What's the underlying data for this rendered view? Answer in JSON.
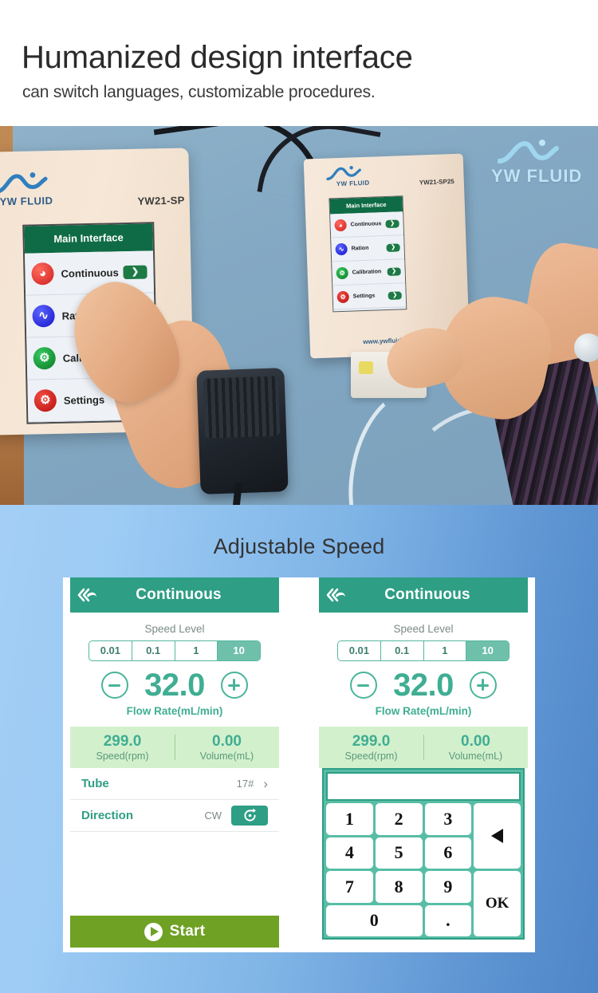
{
  "header": {
    "title": "Humanized design interface",
    "subtitle": "can switch languages, customizable procedures."
  },
  "photo": {
    "watermark_logo": "YW FLUID",
    "left_device": {
      "brand": "YW FLUID",
      "model": "YW21-SP",
      "screen_title": "Main Interface",
      "menu": [
        {
          "label": "Continuous",
          "icon": "drop-icon",
          "glyph": "◕",
          "arrow": "❯",
          "color": "#cf1f1f"
        },
        {
          "label": "Ration",
          "icon": "wave-icon",
          "glyph": "∿",
          "arrow": "❯",
          "color": "#1414c8"
        },
        {
          "label": "Calibration",
          "icon": "gear-icon",
          "glyph": "⚙",
          "arrow": "❯",
          "color": "#0c7a25"
        },
        {
          "label": "Settings",
          "icon": "gear-icon",
          "glyph": "⚙",
          "arrow": "❯",
          "color": "#b51212"
        }
      ]
    },
    "right_device": {
      "brand": "YW FLUID",
      "model": "YW21-SP25",
      "website": "www.ywfluid.com",
      "screen_title": "Main Interface",
      "menu": [
        {
          "label": "Continuous",
          "icon": "drop-icon",
          "glyph": "◕",
          "arrow": "❯"
        },
        {
          "label": "Ration",
          "icon": "wave-icon",
          "glyph": "∿",
          "arrow": "❯"
        },
        {
          "label": "Calibration",
          "icon": "gear-icon",
          "glyph": "⚙",
          "arrow": "❯"
        },
        {
          "label": "Settings",
          "icon": "gear-icon",
          "glyph": "⚙",
          "arrow": "❯"
        }
      ]
    }
  },
  "lower": {
    "section_title": "Adjustable Speed",
    "panel_left": {
      "back_icon": "back-arrow-icon",
      "title": "Continuous",
      "speed_level_label": "Speed Level",
      "levels": [
        "0.01",
        "0.1",
        "1",
        "10"
      ],
      "active_level": "10",
      "minus_label": "−",
      "plus_label": "+",
      "rate_value": "32.0",
      "rate_unit": "Flow Rate(mL/min)",
      "stats": [
        {
          "value": "299.0",
          "key": "Speed(rpm)"
        },
        {
          "value": "0.00",
          "key": "Volume(mL)"
        }
      ],
      "rows": [
        {
          "key": "Tube",
          "value": "17#",
          "chevron": "›"
        },
        {
          "key": "Direction",
          "value": "CW",
          "button_icon": "clockwise-rotate-icon"
        }
      ],
      "start_label": "Start"
    },
    "panel_right": {
      "back_icon": "back-arrow-icon",
      "title": "Continuous",
      "speed_level_label": "Speed Level",
      "levels": [
        "0.01",
        "0.1",
        "1",
        "10"
      ],
      "active_level": "10",
      "rate_value": "32.0",
      "rate_unit": "Flow Rate(mL/min)",
      "stats": [
        {
          "value": "299.0",
          "key": "Speed(rpm)"
        },
        {
          "value": "0.00",
          "key": "Volume(mL)"
        }
      ],
      "keypad": {
        "display_value": "",
        "keys": [
          "1",
          "2",
          "3",
          "4",
          "5",
          "6",
          "7",
          "8",
          "9",
          "0",
          "."
        ],
        "backspace_icon": "backspace-arrow-icon",
        "ok_label": "OK"
      }
    }
  },
  "colors": {
    "teal": "#2e9e85",
    "teal_light": "#6fc0ab",
    "green_text": "#3fae92",
    "stats_bg": "#d3f0cd",
    "start_green": "#6fa124",
    "blue_left": "#a4cef5",
    "blue_right": "#4f86c8"
  }
}
